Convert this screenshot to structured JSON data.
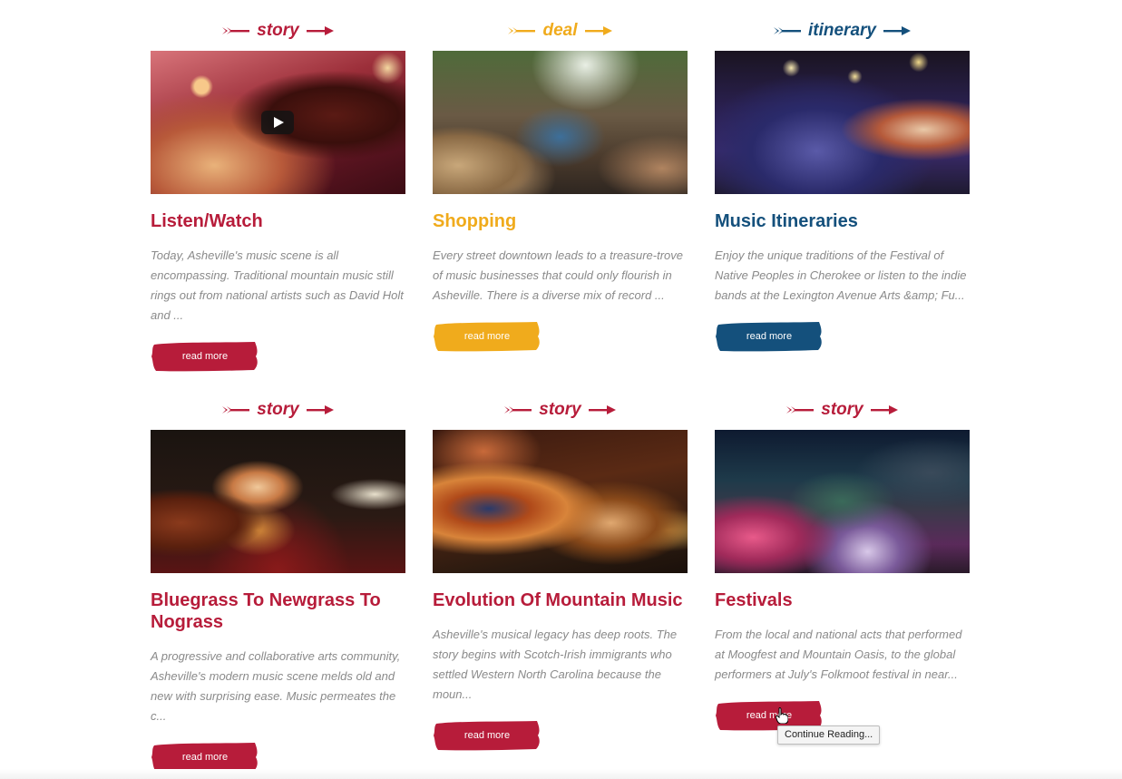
{
  "colors": {
    "red": "#b71c3a",
    "gold": "#f0ab1c",
    "blue": "#14507c"
  },
  "cards": [
    {
      "tag": "story",
      "color": "red",
      "image": "photo-drummer-red-stage",
      "has_play": true,
      "title": "Listen/Watch",
      "description": "Today, Asheville's music scene is all encompassing. Traditional mountain music still rings out from national artists such as David Holt and ...",
      "button": "read more"
    },
    {
      "tag": "deal",
      "color": "gold",
      "image": "photo-drum-circle-outdoors",
      "has_play": false,
      "title": "Shopping",
      "description": "Every street downtown leads to a treasure-trove of music businesses that could only flourish in Asheville. There is a diverse mix of record ...",
      "button": "read more"
    },
    {
      "tag": "itinerary",
      "color": "blue",
      "image": "photo-concert-crowd-fiddler",
      "has_play": false,
      "title": "Music Itineraries",
      "description": "Enjoy the unique traditions of the Festival of Native Peoples in Cherokee or listen to the indie bands at the Lexington Avenue Arts &amp; Fu...",
      "button": "read more"
    },
    {
      "tag": "story",
      "color": "red",
      "image": "photo-bluegrass-band",
      "has_play": false,
      "title": "Bluegrass To Newgrass To Nograss",
      "description": "A progressive and collaborative arts community, Asheville's modern music scene melds old and new with surprising ease. Music permeates the c...",
      "button": "read more"
    },
    {
      "tag": "story",
      "color": "red",
      "image": "photo-guitar-saxophone",
      "has_play": false,
      "title": "Evolution Of Mountain Music",
      "description": "Asheville's musical legacy has deep roots. The story begins with Scotch-Irish immigrants who settled Western North Carolina because the moun...",
      "button": "read more"
    },
    {
      "tag": "story",
      "color": "red",
      "image": "photo-outdoor-festival-stage",
      "has_play": false,
      "title": "Festivals",
      "description": "From the local and national acts that performed at Moogfest and Mountain Oasis, to the global performers at July's Folkmoot festival in near...",
      "button": "read more"
    }
  ],
  "tooltip": "Continue Reading..."
}
